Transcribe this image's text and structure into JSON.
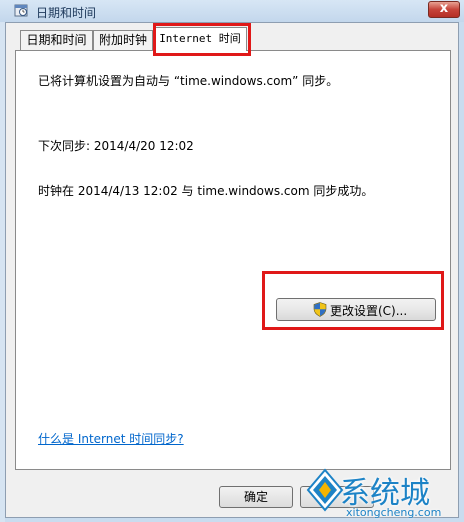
{
  "window": {
    "title": "日期和时间",
    "close_symbol": "x",
    "close_icon": "close-icon",
    "app_icon": "clock-calendar-icon"
  },
  "tabs": [
    {
      "label": "日期和时间",
      "active": false
    },
    {
      "label": "附加时钟",
      "active": false
    },
    {
      "label": "Internet 时间",
      "active": true
    }
  ],
  "panel": {
    "sync_status": "已将计算机设置为自动与 “time.windows.com” 同步。",
    "next_sync": "下次同步: 2014/4/20 12:02",
    "last_sync_result": "时钟在 2014/4/13 12:02 与 time.windows.com 同步成功。",
    "change_settings_button": "更改设置(C)...",
    "help_link": "什么是 Internet 时间同步?"
  },
  "footer": {
    "ok_label": "确定"
  },
  "watermark": {
    "brand": "系统城",
    "url": "xitongcheng.com"
  },
  "colors": {
    "highlight": "#e01818",
    "link": "#0066cc",
    "watermark": "#1d83c6"
  }
}
